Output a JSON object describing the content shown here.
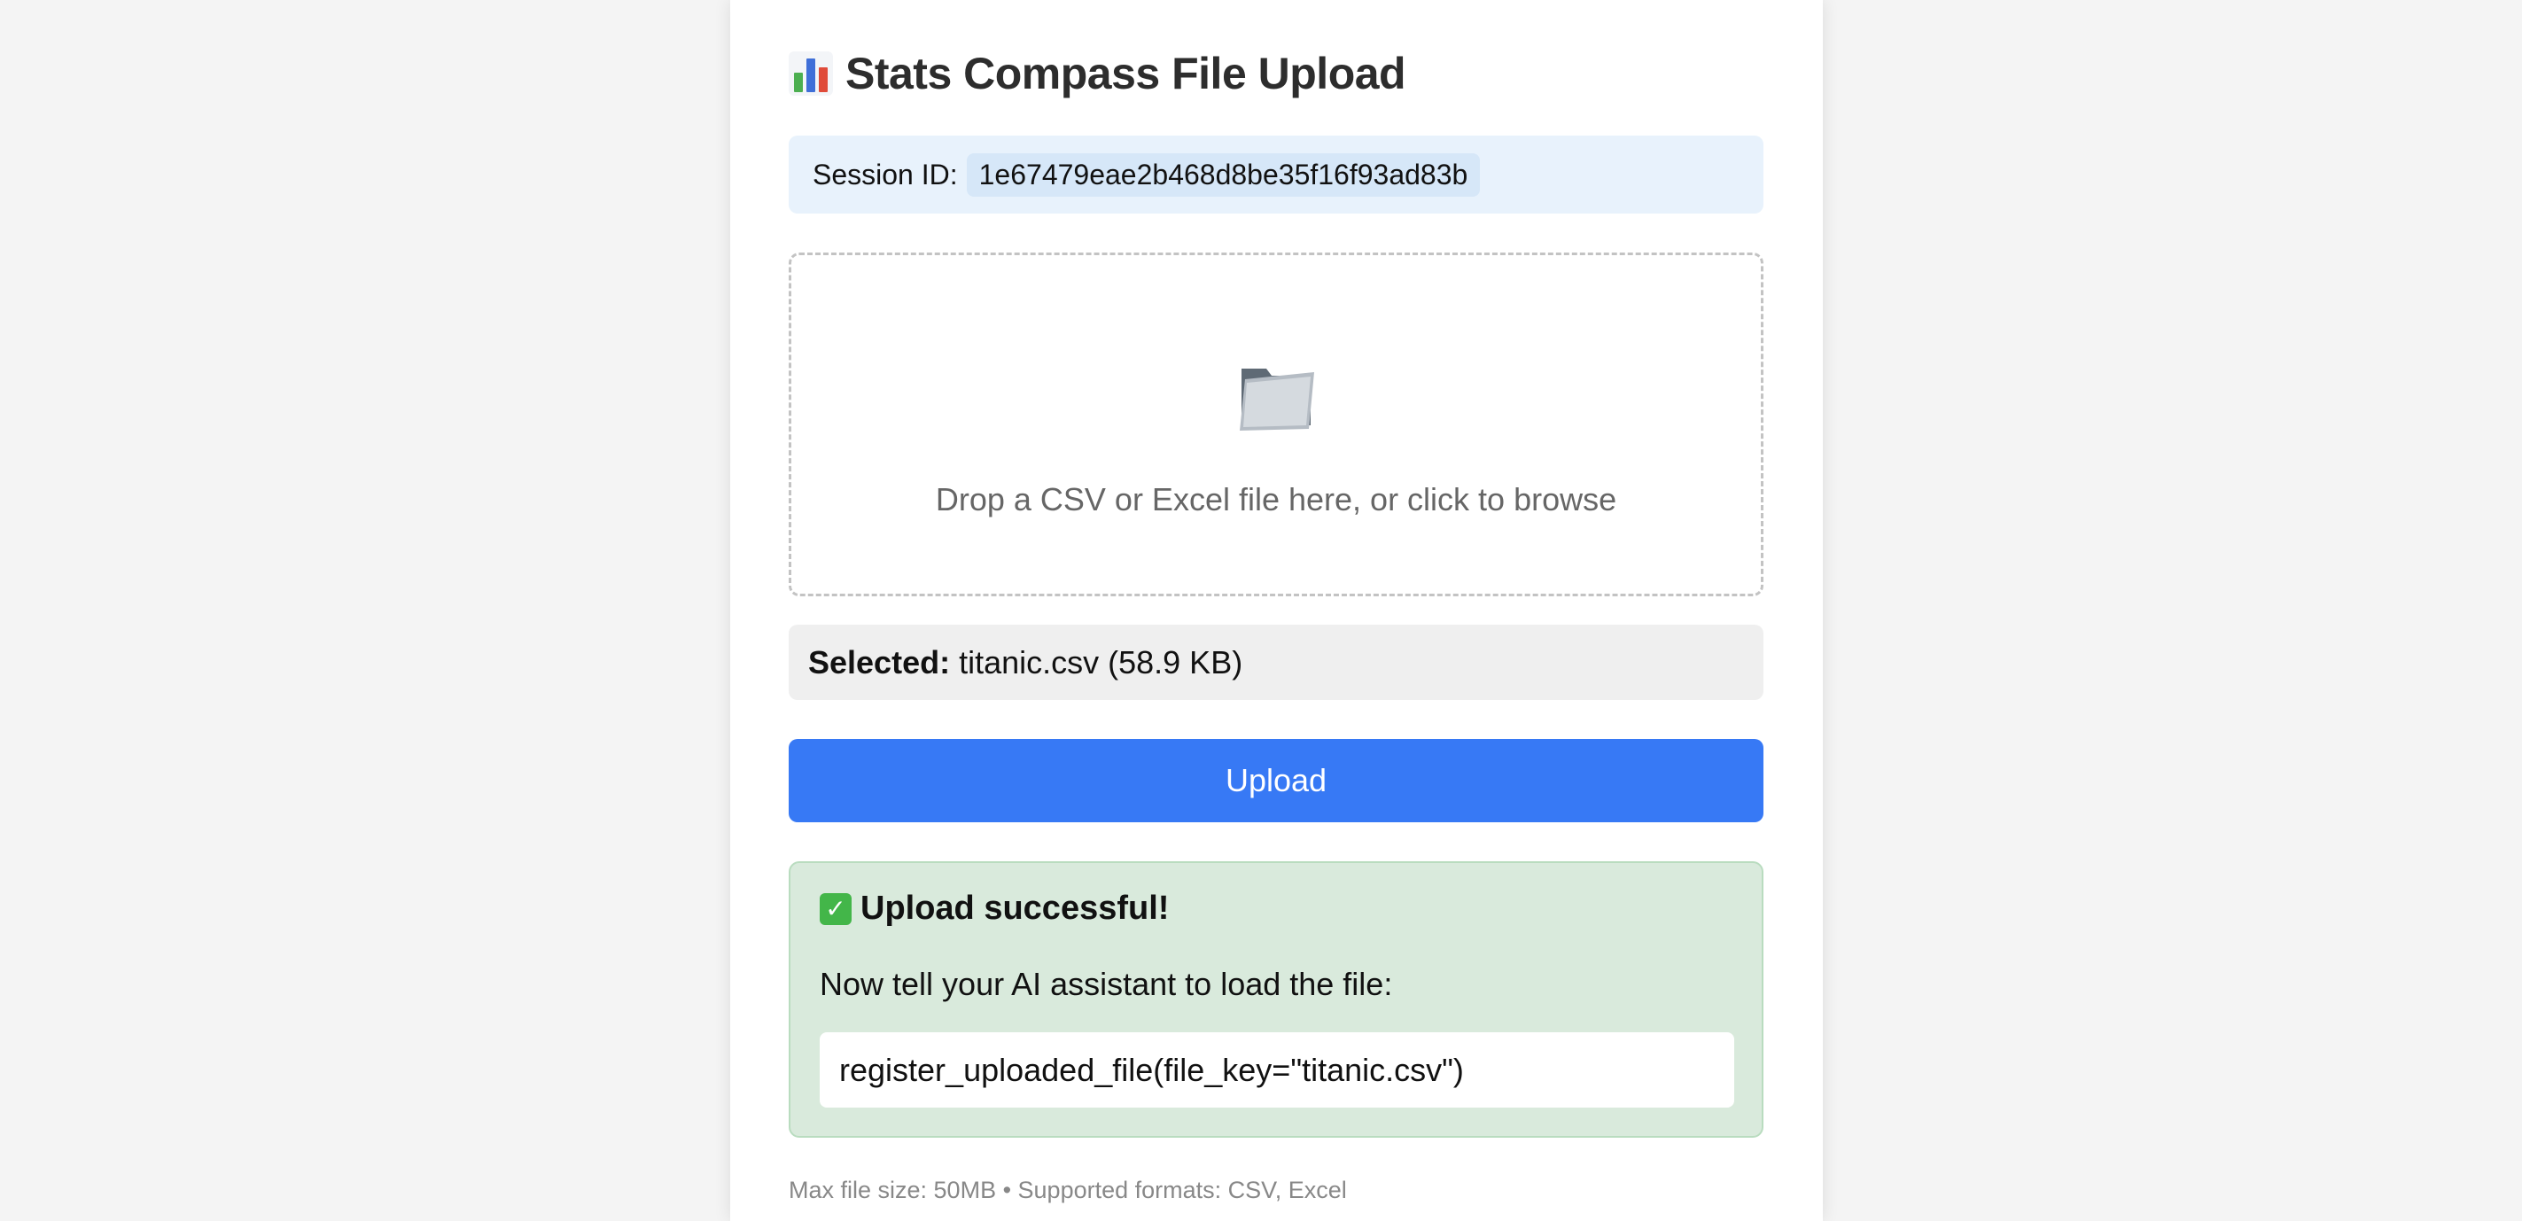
{
  "header": {
    "title": "Stats Compass File Upload",
    "icon": "bar-chart-icon"
  },
  "session": {
    "label": "Session ID:",
    "id": "1e67479eae2b468d8be35f16f93ad83b"
  },
  "dropzone": {
    "icon": "folder-icon",
    "text": "Drop a CSV or Excel file here, or click to browse"
  },
  "selected": {
    "label": "Selected:",
    "file": "titanic.csv (58.9 KB)"
  },
  "upload_button": {
    "label": "Upload"
  },
  "success": {
    "icon": "check-icon",
    "title": "Upload successful!",
    "message": "Now tell your AI assistant to load the file:",
    "command": "register_uploaded_file(file_key=\"titanic.csv\")"
  },
  "footer": {
    "note": "Max file size: 50MB • Supported formats: CSV, Excel"
  },
  "colors": {
    "accent": "#3779f5",
    "success_bg": "#d9eadc",
    "session_bg": "#e8f2fc"
  }
}
